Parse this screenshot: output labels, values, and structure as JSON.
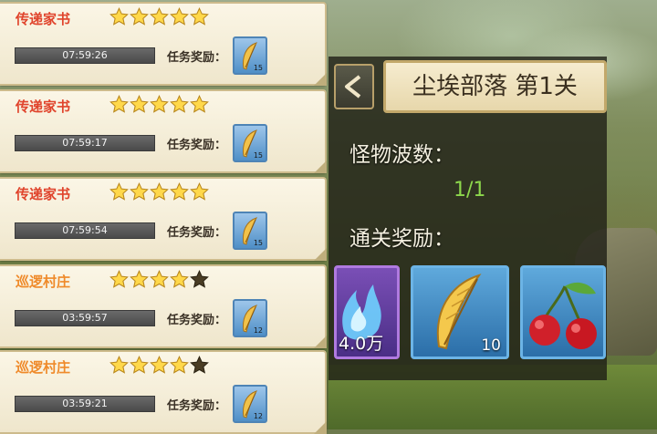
{
  "quests": [
    {
      "title": "传递家书",
      "title_color": "#e0442c",
      "stars_filled": 5,
      "stars_total": 5,
      "timer": "07:59:26",
      "reward_label": "任务奖励：",
      "reward_count": "15"
    },
    {
      "title": "传递家书",
      "title_color": "#e0442c",
      "stars_filled": 5,
      "stars_total": 5,
      "timer": "07:59:17",
      "reward_label": "任务奖励：",
      "reward_count": "15"
    },
    {
      "title": "传递家书",
      "title_color": "#e0442c",
      "stars_filled": 5,
      "stars_total": 5,
      "timer": "07:59:54",
      "reward_label": "任务奖励：",
      "reward_count": "15"
    },
    {
      "title": "巡逻村庄",
      "title_color": "#ef8a2a",
      "stars_filled": 4,
      "stars_total": 5,
      "timer": "03:59:57",
      "reward_label": "任务奖励：",
      "reward_count": "12"
    },
    {
      "title": "巡逻村庄",
      "title_color": "#ef8a2a",
      "stars_filled": 4,
      "stars_total": 5,
      "timer": "03:59:21",
      "reward_label": "任务奖励：",
      "reward_count": "12"
    }
  ],
  "stage": {
    "title": "尘埃部落 第1关",
    "wave_label": "怪物波数：",
    "wave_value": "1/1",
    "reward_label": "通关奖励：",
    "rewards": [
      {
        "icon": "spirit-flame-icon",
        "count": "4.0万"
      },
      {
        "icon": "golden-feather-icon",
        "count": "10"
      },
      {
        "icon": "cherry-icon",
        "count": ""
      }
    ]
  },
  "colors": {
    "star_filled": "#ffd84a",
    "star_empty": "#4a3d24",
    "wave_value": "#8dd84c"
  }
}
